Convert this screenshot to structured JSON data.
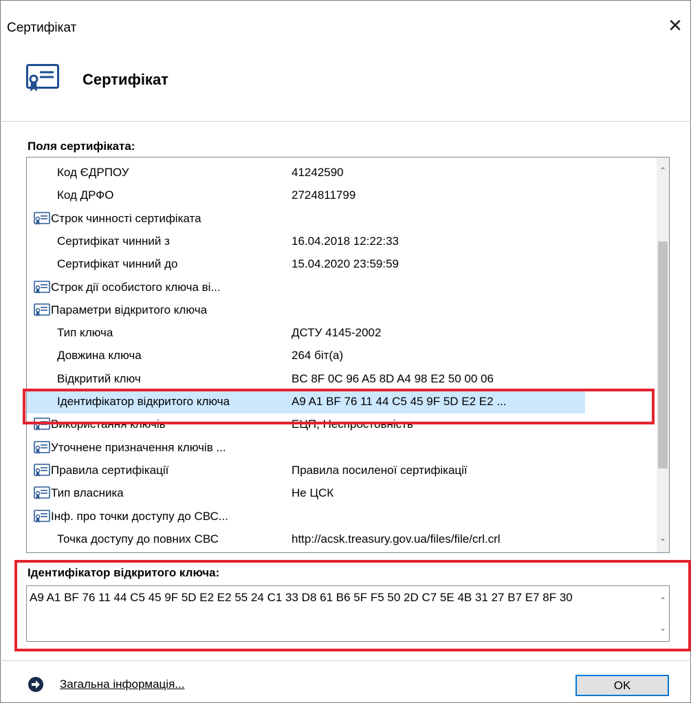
{
  "window": {
    "title": "Сертифікат",
    "close_label": "✕"
  },
  "header": {
    "title": "Сертифікат",
    "icon": "certificate-icon"
  },
  "fields": {
    "label": "Поля сертифіката:",
    "rows": [
      {
        "name": "Код ЄДРПОУ",
        "value": "41242590",
        "icon": false,
        "indent": true
      },
      {
        "name": "Код ДРФО",
        "value": "2724811799",
        "icon": false,
        "indent": true
      },
      {
        "name": "Строк чинності сертифіката",
        "value": "",
        "icon": true,
        "indent": false
      },
      {
        "name": "Сертифікат чинний з",
        "value": "16.04.2018 12:22:33",
        "icon": false,
        "indent": true
      },
      {
        "name": "Сертифікат чинний до",
        "value": "15.04.2020 23:59:59",
        "icon": false,
        "indent": true
      },
      {
        "name": "Строк дії особистого ключа ві...",
        "value": "",
        "icon": true,
        "indent": false
      },
      {
        "name": "Параметри відкритого ключа",
        "value": "",
        "icon": true,
        "indent": false
      },
      {
        "name": "Тип ключа",
        "value": "ДСТУ 4145-2002",
        "icon": false,
        "indent": true
      },
      {
        "name": "Довжина ключа",
        "value": "264 біт(а)",
        "icon": false,
        "indent": true
      },
      {
        "name": "Відкритий ключ",
        "value": "BC 8F 0C 96 A5 8D A4 98 E2 50 00 06",
        "icon": false,
        "indent": true
      },
      {
        "name": "Ідентифікатор відкритого ключа",
        "value": "A9 A1 BF 76 11 44 C5 45 9F 5D E2 E2 ...",
        "icon": false,
        "indent": true,
        "selected": true
      },
      {
        "name": "Використання ключів",
        "value": "ЕЦП, Неспростовність",
        "icon": true,
        "indent": false
      },
      {
        "name": "Уточнене призначення ключів ...",
        "value": "",
        "icon": true,
        "indent": false
      },
      {
        "name": "Правила сертифікації",
        "value": "Правила посиленої сертифікації",
        "icon": true,
        "indent": false
      },
      {
        "name": "Тип власника",
        "value": "Не ЦСК",
        "icon": true,
        "indent": false
      },
      {
        "name": "Інф. про точки доступу до СВС...",
        "value": "",
        "icon": true,
        "indent": false
      },
      {
        "name": "Точка доступу до повних СВС",
        "value": "http://acsk.treasury.gov.ua/files/file/crl.crl",
        "icon": false,
        "indent": true
      }
    ]
  },
  "detail": {
    "label": "Ідентифікатор відкритого ключа:",
    "value": "A9 A1 BF 76 11 44 C5 45 9F 5D E2 E2 55 24 C1 33 D8 61 B6 5F F5 50 2D C7 5E 4B 31 27 B7 E7 8F 30"
  },
  "footer": {
    "info_link": "Загальна інформація...",
    "ok_label": "OK"
  },
  "colors": {
    "selection": "#cce8ff",
    "highlight_border": "#e3232f",
    "button_border": "#0078d7"
  }
}
